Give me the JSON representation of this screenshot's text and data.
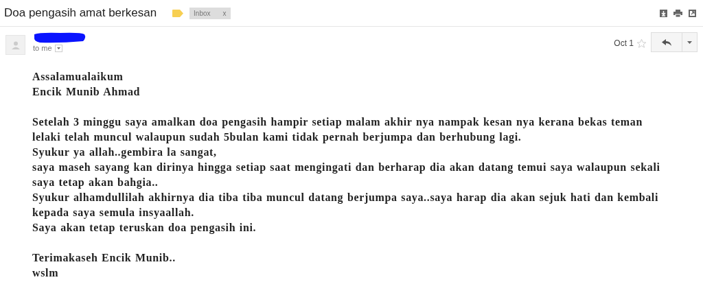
{
  "subject": "Doa pengasih amat berkesan",
  "label": {
    "text": "Inbox",
    "remove": "x"
  },
  "message": {
    "to": "to me",
    "date": "Oct 1",
    "starred": false
  },
  "body": [
    {
      "lines": [
        "Assalamualaikum",
        "Encik Munib Ahmad"
      ]
    },
    {
      "lines": [
        "Setelah 3 minggu saya amalkan doa pengasih hampir setiap malam akhir nya nampak kesan nya kerana bekas teman lelaki telah muncul walaupun sudah 5bulan kami tidak pernah berjumpa dan berhubung lagi.",
        "Syukur ya allah..gembira la sangat,",
        "saya maseh sayang kan dirinya hingga setiap saat mengingati dan berharap dia akan datang temui saya walaupun sekali saya tetap akan bahgia..",
        "Syukur alhamdullilah akhirnya dia tiba tiba muncul datang berjumpa saya..saya harap dia akan sejuk hati dan kembali kepada saya semula insyaallah.",
        "Saya akan tetap teruskan doa pengasih ini."
      ]
    },
    {
      "lines": [
        "Terimakaseh Encik Munib..",
        "wslm"
      ]
    }
  ]
}
